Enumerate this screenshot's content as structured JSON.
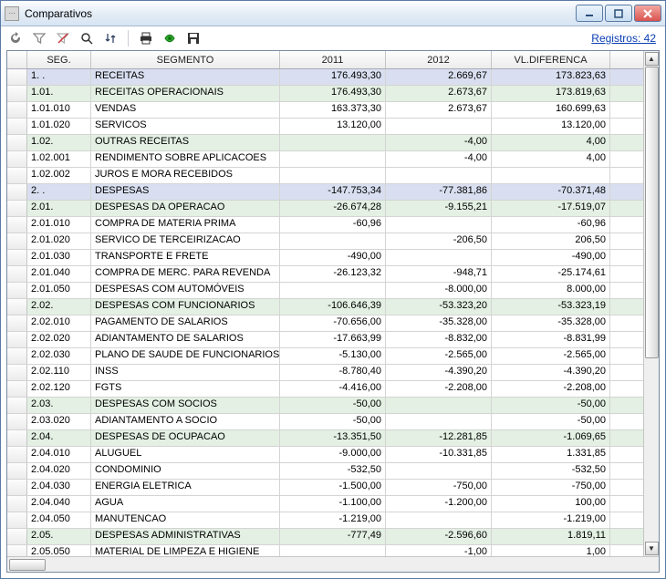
{
  "window": {
    "title": "Comparativos"
  },
  "toolbar": {
    "records_link": "Registros: 42"
  },
  "columns": {
    "seg": "SEG.",
    "segmento": "SEGMENTO",
    "y2011": "2011",
    "y2012": "2012",
    "diff": "VL.DIFERENCA"
  },
  "rows": [
    {
      "level": 0,
      "seg": "1. .",
      "segmento": "RECEITAS",
      "y2011": "176.493,30",
      "y2012": "2.669,67",
      "diff": "173.823,63"
    },
    {
      "level": 1,
      "seg": "1.01.",
      "segmento": "RECEITAS OPERACIONAIS",
      "y2011": "176.493,30",
      "y2012": "2.673,67",
      "diff": "173.819,63"
    },
    {
      "level": 2,
      "seg": "1.01.010",
      "segmento": "VENDAS",
      "y2011": "163.373,30",
      "y2012": "2.673,67",
      "diff": "160.699,63"
    },
    {
      "level": 2,
      "seg": "1.01.020",
      "segmento": "SERVICOS",
      "y2011": "13.120,00",
      "y2012": "",
      "diff": "13.120,00"
    },
    {
      "level": 1,
      "seg": "1.02.",
      "segmento": "OUTRAS RECEITAS",
      "y2011": "",
      "y2012": "-4,00",
      "diff": "4,00"
    },
    {
      "level": 2,
      "seg": "1.02.001",
      "segmento": "RENDIMENTO SOBRE APLICACOES",
      "y2011": "",
      "y2012": "-4,00",
      "diff": "4,00"
    },
    {
      "level": 2,
      "seg": "1.02.002",
      "segmento": "JUROS E MORA RECEBIDOS",
      "y2011": "",
      "y2012": "",
      "diff": ""
    },
    {
      "level": 0,
      "seg": "2. .",
      "segmento": "DESPESAS",
      "y2011": "-147.753,34",
      "y2012": "-77.381,86",
      "diff": "-70.371,48"
    },
    {
      "level": 1,
      "seg": "2.01.",
      "segmento": "DESPESAS DA OPERACAO",
      "y2011": "-26.674,28",
      "y2012": "-9.155,21",
      "diff": "-17.519,07"
    },
    {
      "level": 2,
      "seg": "2.01.010",
      "segmento": "COMPRA DE MATERIA PRIMA",
      "y2011": "-60,96",
      "y2012": "",
      "diff": "-60,96"
    },
    {
      "level": 2,
      "seg": "2.01.020",
      "segmento": "SERVICO DE TERCEIRIZACAO",
      "y2011": "",
      "y2012": "-206,50",
      "diff": "206,50"
    },
    {
      "level": 2,
      "seg": "2.01.030",
      "segmento": "TRANSPORTE E FRETE",
      "y2011": "-490,00",
      "y2012": "",
      "diff": "-490,00"
    },
    {
      "level": 2,
      "seg": "2.01.040",
      "segmento": "COMPRA DE MERC. PARA REVENDA",
      "y2011": "-26.123,32",
      "y2012": "-948,71",
      "diff": "-25.174,61"
    },
    {
      "level": 2,
      "seg": "2.01.050",
      "segmento": "DESPESAS COM AUTOMÓVEIS",
      "y2011": "",
      "y2012": "-8.000,00",
      "diff": "8.000,00"
    },
    {
      "level": 1,
      "seg": "2.02.",
      "segmento": "DESPESAS COM FUNCIONARIOS",
      "y2011": "-106.646,39",
      "y2012": "-53.323,20",
      "diff": "-53.323,19"
    },
    {
      "level": 2,
      "seg": "2.02.010",
      "segmento": "PAGAMENTO DE SALARIOS",
      "y2011": "-70.656,00",
      "y2012": "-35.328,00",
      "diff": "-35.328,00"
    },
    {
      "level": 2,
      "seg": "2.02.020",
      "segmento": "ADIANTAMENTO DE SALARIOS",
      "y2011": "-17.663,99",
      "y2012": "-8.832,00",
      "diff": "-8.831,99"
    },
    {
      "level": 2,
      "seg": "2.02.030",
      "segmento": "PLANO DE SAUDE DE FUNCIONARIOS",
      "y2011": "-5.130,00",
      "y2012": "-2.565,00",
      "diff": "-2.565,00"
    },
    {
      "level": 2,
      "seg": "2.02.110",
      "segmento": "INSS",
      "y2011": "-8.780,40",
      "y2012": "-4.390,20",
      "diff": "-4.390,20"
    },
    {
      "level": 2,
      "seg": "2.02.120",
      "segmento": "FGTS",
      "y2011": "-4.416,00",
      "y2012": "-2.208,00",
      "diff": "-2.208,00"
    },
    {
      "level": 1,
      "seg": "2.03.",
      "segmento": "DESPESAS COM SOCIOS",
      "y2011": "-50,00",
      "y2012": "",
      "diff": "-50,00"
    },
    {
      "level": 2,
      "seg": "2.03.020",
      "segmento": "ADIANTAMENTO A SOCIO",
      "y2011": "-50,00",
      "y2012": "",
      "diff": "-50,00"
    },
    {
      "level": 1,
      "seg": "2.04.",
      "segmento": "DESPESAS DE OCUPACAO",
      "y2011": "-13.351,50",
      "y2012": "-12.281,85",
      "diff": "-1.069,65"
    },
    {
      "level": 2,
      "seg": "2.04.010",
      "segmento": "ALUGUEL",
      "y2011": "-9.000,00",
      "y2012": "-10.331,85",
      "diff": "1.331,85"
    },
    {
      "level": 2,
      "seg": "2.04.020",
      "segmento": "CONDOMINIO",
      "y2011": "-532,50",
      "y2012": "",
      "diff": "-532,50"
    },
    {
      "level": 2,
      "seg": "2.04.030",
      "segmento": "ENERGIA ELETRICA",
      "y2011": "-1.500,00",
      "y2012": "-750,00",
      "diff": "-750,00"
    },
    {
      "level": 2,
      "seg": "2.04.040",
      "segmento": "AGUA",
      "y2011": "-1.100,00",
      "y2012": "-1.200,00",
      "diff": "100,00"
    },
    {
      "level": 2,
      "seg": "2.04.050",
      "segmento": "MANUTENCAO",
      "y2011": "-1.219,00",
      "y2012": "",
      "diff": "-1.219,00"
    },
    {
      "level": 1,
      "seg": "2.05.",
      "segmento": "DESPESAS ADMINISTRATIVAS",
      "y2011": "-777,49",
      "y2012": "-2.596,60",
      "diff": "1.819,11"
    },
    {
      "level": 2,
      "seg": "2.05.050",
      "segmento": "MATERIAL DE LIMPEZA E HIGIENE",
      "y2011": "",
      "y2012": "-1,00",
      "diff": "1,00"
    }
  ]
}
